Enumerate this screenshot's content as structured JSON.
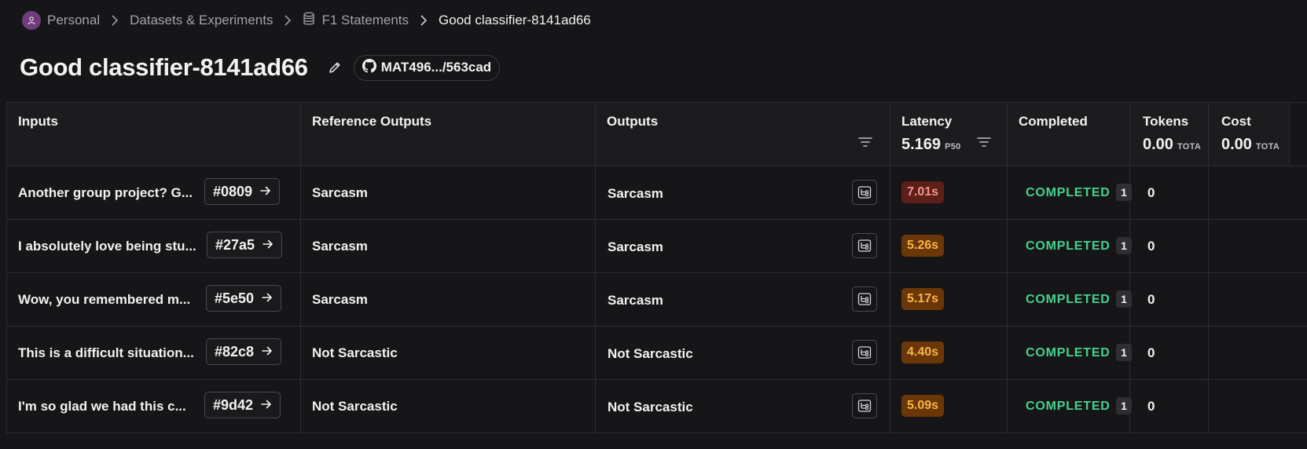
{
  "breadcrumb": {
    "personal": "Personal",
    "datasets": "Datasets & Experiments",
    "dataset": "F1 Statements",
    "current": "Good classifier-8141ad66"
  },
  "header": {
    "title": "Good classifier-8141ad66",
    "commit": "MAT496.../563cad"
  },
  "columns": {
    "inputs": "Inputs",
    "reference_outputs": "Reference Outputs",
    "outputs": "Outputs",
    "latency": "Latency",
    "latency_value": "5.169",
    "latency_unit": "P50",
    "completed": "Completed",
    "tokens": "Tokens",
    "tokens_value": "0.00",
    "tokens_unit": "TOTA",
    "cost": "Cost",
    "cost_value": "0.00",
    "cost_unit": "TOTA"
  },
  "rows": [
    {
      "input": "Another group project? G...",
      "id": "#0809",
      "reference": "Sarcasm",
      "output": "Sarcasm",
      "latency": "7.01s",
      "latency_color": "#5e1e1a",
      "latency_text": "#f2978a",
      "status": "COMPLETED",
      "count": "1",
      "tokens": "0"
    },
    {
      "input": "I absolutely love being stu...",
      "id": "#27a5",
      "reference": "Sarcasm",
      "output": "Sarcasm",
      "latency": "5.26s",
      "latency_color": "#6b3708",
      "latency_text": "#f9b545",
      "status": "COMPLETED",
      "count": "1",
      "tokens": "0"
    },
    {
      "input": "Wow, you remembered m...",
      "id": "#5e50",
      "reference": "Sarcasm",
      "output": "Sarcasm",
      "latency": "5.17s",
      "latency_color": "#6b3708",
      "latency_text": "#f9b545",
      "status": "COMPLETED",
      "count": "1",
      "tokens": "0"
    },
    {
      "input": "This is a difficult situation...",
      "id": "#82c8",
      "reference": "Not Sarcastic",
      "output": "Not Sarcastic",
      "latency": "4.40s",
      "latency_color": "#6b3708",
      "latency_text": "#f9b545",
      "status": "COMPLETED",
      "count": "1",
      "tokens": "0"
    },
    {
      "input": "I'm so glad we had this c...",
      "id": "#9d42",
      "reference": "Not Sarcastic",
      "output": "Not Sarcastic",
      "latency": "5.09s",
      "latency_color": "#6b3708",
      "latency_text": "#f9b545",
      "status": "COMPLETED",
      "count": "1",
      "tokens": "0"
    }
  ],
  "icons": {
    "avatar": "user-avatar-icon",
    "separator": "chevron-right-icon",
    "dataset": "database-icon",
    "edit": "pencil-icon",
    "commit": "github-icon",
    "filter": "filter-icon",
    "open": "arrow-right-icon",
    "trace": "trace-tree-icon"
  },
  "colors": {
    "background": "#161618",
    "header_background": "#1c1c1f",
    "status_completed": "#45d08f"
  }
}
